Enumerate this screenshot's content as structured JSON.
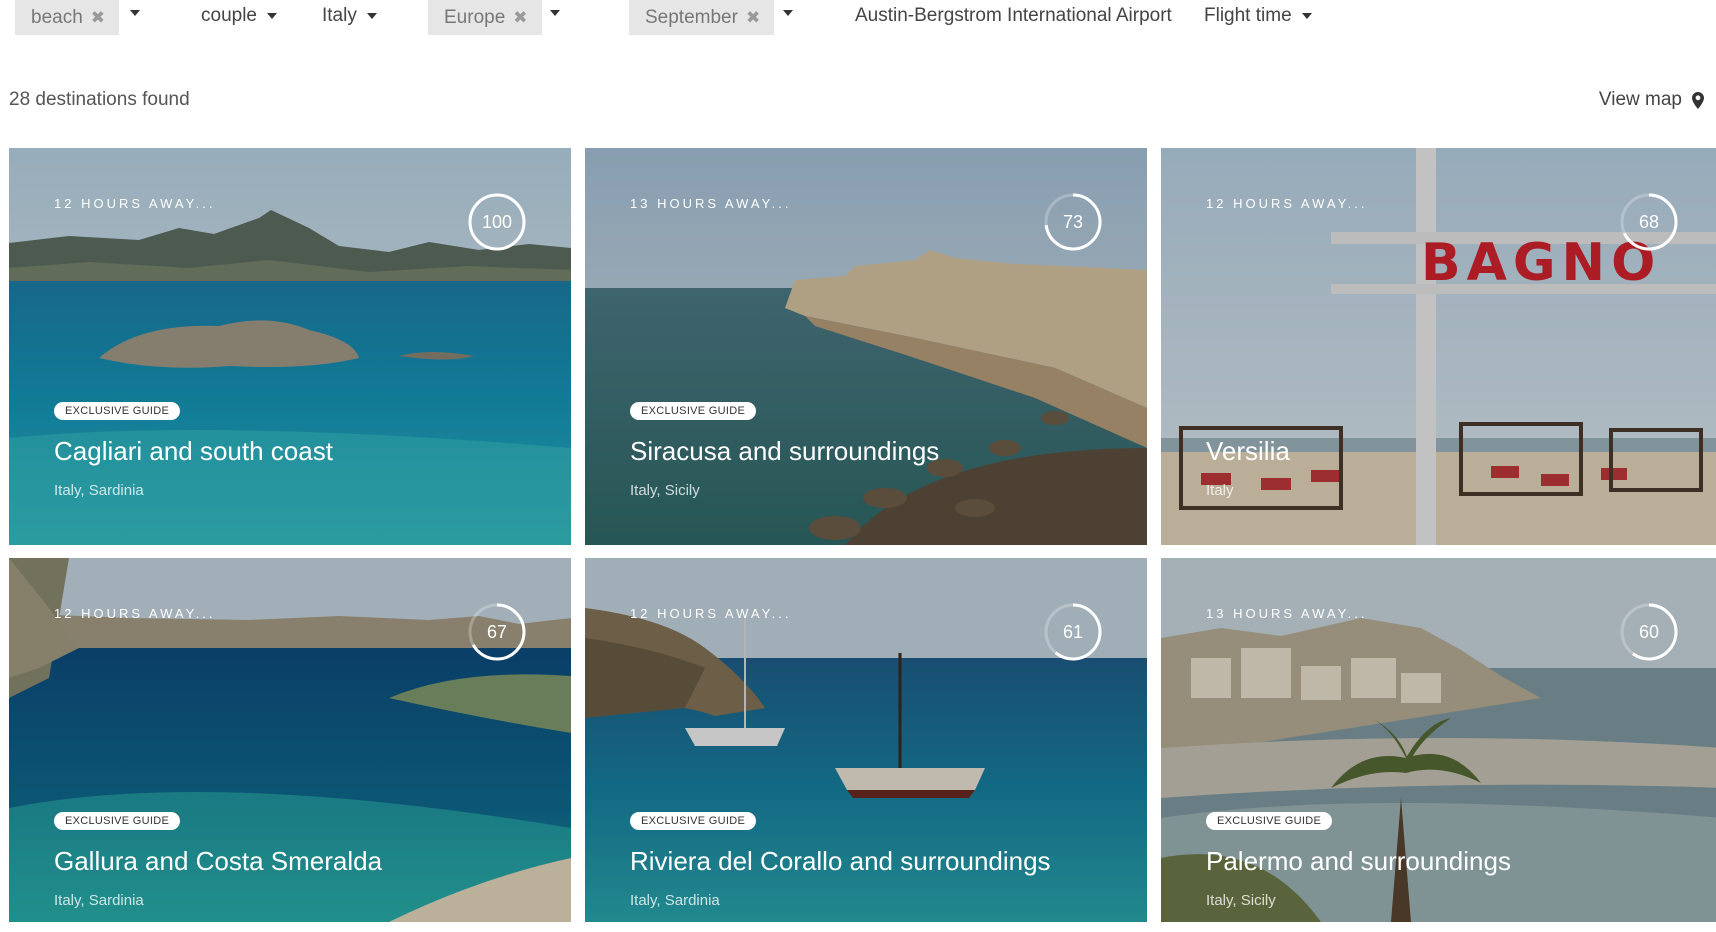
{
  "filters": {
    "chips": [
      {
        "label": "beach"
      },
      {
        "label": "Europe"
      },
      {
        "label": "September"
      }
    ],
    "dropdowns": [
      {
        "label": "couple"
      },
      {
        "label": "Italy"
      }
    ],
    "airport": "Austin-Bergstrom International Airport",
    "sort": "Flight time"
  },
  "results": {
    "count_text": "28 destinations found",
    "view_map": "View map"
  },
  "cards": [
    {
      "hours": "12 HOURS AWAY...",
      "score": 100,
      "score_text": "100",
      "badge": "EXCLUSIVE GUIDE",
      "title": "Cagliari and south coast",
      "subtitle": "Italy, Sardinia"
    },
    {
      "hours": "13 HOURS AWAY...",
      "score": 73,
      "score_text": "73",
      "badge": "EXCLUSIVE GUIDE",
      "title": "Siracusa and surroundings",
      "subtitle": "Italy, Sicily"
    },
    {
      "hours": "12 HOURS AWAY...",
      "score": 68,
      "score_text": "68",
      "badge": "",
      "title": "Versilia",
      "subtitle": "Italy",
      "sign_text": "BAGNO"
    },
    {
      "hours": "12 HOURS AWAY...",
      "score": 67,
      "score_text": "67",
      "badge": "EXCLUSIVE GUIDE",
      "title": "Gallura and Costa Smeralda",
      "subtitle": "Italy, Sardinia"
    },
    {
      "hours": "12 HOURS AWAY...",
      "score": 61,
      "score_text": "61",
      "badge": "EXCLUSIVE GUIDE",
      "title": "Riviera del Corallo and surroundings",
      "subtitle": "Italy, Sardinia"
    },
    {
      "hours": "13 HOURS AWAY...",
      "score": 60,
      "score_text": "60",
      "badge": "EXCLUSIVE GUIDE",
      "title": "Palermo and surroundings",
      "subtitle": "Italy, Sicily"
    }
  ],
  "colors": {
    "chip_bg": "#e6e6e6",
    "sign_red": "#d2232e"
  }
}
